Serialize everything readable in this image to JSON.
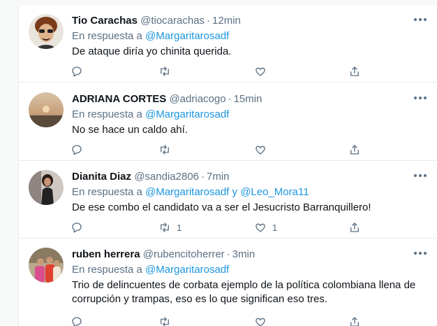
{
  "tweets": [
    {
      "name": "Tio Carachas",
      "handle": "@tiocarachas",
      "time": "12min",
      "reply_prefix": "En respuesta a ",
      "mention1": "@Margaritarosadf",
      "mention_join": "",
      "mention2": "",
      "text": "De ataque diría yo chinita querida.",
      "retweets": "",
      "likes": ""
    },
    {
      "name": "ADRIANA CORTES",
      "handle": "@adriacogo",
      "time": "15min",
      "reply_prefix": "En respuesta a ",
      "mention1": "@Margaritarosadf",
      "mention_join": "",
      "mention2": "",
      "text": "No se hace un caldo ahí.",
      "retweets": "",
      "likes": ""
    },
    {
      "name": "Dianita Diaz",
      "handle": "@sandia2806",
      "time": "7min",
      "reply_prefix": "En respuesta a ",
      "mention1": "@Margaritarosadf",
      "mention_join": " y ",
      "mention2": "@Leo_Mora11",
      "text": "De ese combo el candidato va a ser el Jesucristo Barranquillero!",
      "retweets": "1",
      "likes": "1"
    },
    {
      "name": "ruben herrera",
      "handle": "@rubencitoherrer",
      "time": "3min",
      "reply_prefix": "En respuesta a ",
      "mention1": "@Margaritarosadf",
      "mention_join": "",
      "mention2": "",
      "text": "Trio de delincuentes de corbata ejemplo de la política colombiana llena de corrupción y trampas, eso es lo que significan eso tres.",
      "retweets": "",
      "likes": ""
    }
  ],
  "separator": "·",
  "icons": {
    "reply": "reply-icon",
    "retweet": "retweet-icon",
    "like": "heart-icon",
    "share": "share-icon",
    "more": "more-dots-icon"
  },
  "colors": {
    "name": "#0f1419",
    "secondary": "#5b7083",
    "link": "#1b95e0",
    "divider": "#e6ecf0"
  }
}
